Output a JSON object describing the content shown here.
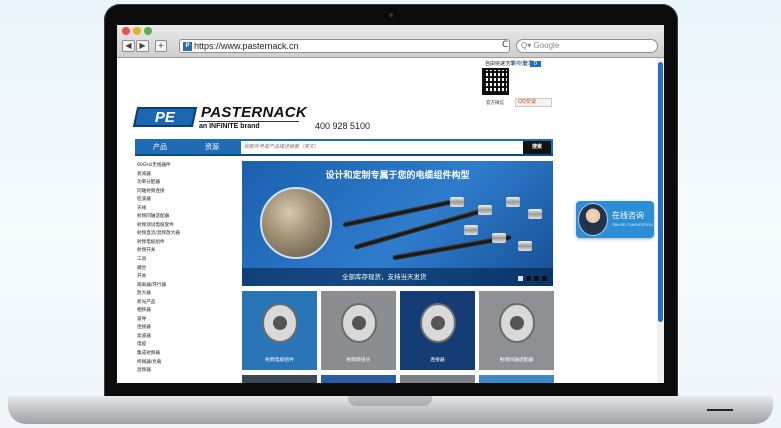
{
  "browser": {
    "url": "https://www.pasternack.cn",
    "search_placeholder": "Google",
    "back": "◀",
    "forward": "▶",
    "add": "+",
    "reload": "C"
  },
  "header": {
    "links": [
      "自由快速下单",
      "登录"
    ],
    "cart_label": "购物车",
    "cart_count": "0",
    "wechat": "官方微信",
    "qq": "QQ交谈",
    "logo": "PE",
    "brand_name": "PASTERNACK",
    "tagline": "an INFINITE brand",
    "phone": "400 928 5100"
  },
  "nav": {
    "items": [
      "产品",
      "资源"
    ],
    "search_placeholder": "按部件号或产品描述搜索（英文）",
    "search_button": "搜索"
  },
  "sidebar": {
    "items": [
      "60GHz无线器件",
      "衰减器",
      "功率分配器",
      "同轴射频连接",
      "检波器",
      "天线",
      "射频同轴适配器",
      "射频测试电缆套件",
      "射频直流/混频放大器",
      "射频电缆组件",
      "射频开关",
      "工具",
      "耦合",
      "开关",
      "隔离器/环行器",
      "放大器",
      "新光产品",
      "相移器",
      "波导",
      "连接器",
      "滤波器",
      "电缆",
      "集成射频器",
      "终端器/负载",
      "混频器"
    ]
  },
  "banner": {
    "title": "设计和定制专属于您的电缆组件构型",
    "caption": "全部库存现货，支持当天发货"
  },
  "tiles": [
    {
      "label": "射频电缆组件",
      "color": "#2a74b8"
    },
    {
      "label": "射频转接头",
      "color": "#8c8d90"
    },
    {
      "label": "连接器",
      "color": "#143b73"
    },
    {
      "label": "射频同轴适配器",
      "color": "#8e9095"
    }
  ],
  "tiles_row2": [
    {
      "color": "#3b4956"
    },
    {
      "color": "#2a5da6"
    },
    {
      "color": "#7c7f85"
    },
    {
      "color": "#3d89c7"
    }
  ],
  "chat": {
    "label": "在线咨询",
    "sub": "ONLINE CONSULTATION"
  }
}
